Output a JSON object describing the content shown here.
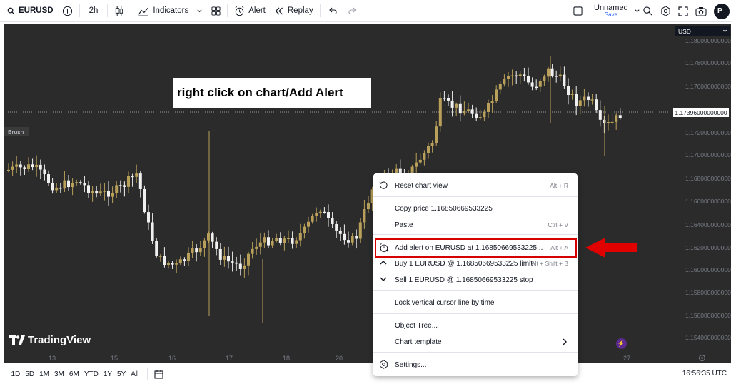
{
  "toolbar": {
    "symbol": "EURUSD",
    "interval": "2h",
    "indicators_label": "Indicators",
    "alert_label": "Alert",
    "replay_label": "Replay",
    "layout_name": "Unnamed",
    "layout_status": "Save",
    "avatar_text": "P"
  },
  "chart": {
    "currency": "USD",
    "brush_label": "Brush",
    "last_price": "1.17396000000000",
    "price_ticks": [
      "1.18000000000000",
      "1.17800000000000",
      "1.17600000000000",
      "1.17200000000000",
      "1.17000000000000",
      "1.16800000000000",
      "1.16600000000000",
      "1.16400000000000",
      "1.16200000000000",
      "1.16000000000000",
      "1.15800000000000",
      "1.15600000000000",
      "1.15400000000000"
    ],
    "date_ticks": [
      "13",
      "15",
      "16",
      "17",
      "18",
      "20",
      "27"
    ],
    "logo_text": "TradingView",
    "annotation": "right click on chart/Add Alert",
    "colors": {
      "bg": "#2b2b2b",
      "up": "#b8a05a",
      "down": "#f0f0f0",
      "accent": "#d50000"
    }
  },
  "ranges": [
    "1D",
    "5D",
    "1M",
    "3M",
    "6M",
    "YTD",
    "1Y",
    "5Y",
    "All"
  ],
  "clock": "16:56:35 UTC",
  "menu": {
    "items": [
      {
        "label": "Reset chart view",
        "shortcut": "Alt + R",
        "icon": "reset-icon"
      },
      {
        "label": "Copy price 1.16850669533225",
        "shortcut": "",
        "icon": ""
      },
      {
        "label": "Paste",
        "shortcut": "Ctrl + V",
        "icon": ""
      },
      {
        "label": "Add alert on EURUSD at 1.16850669533225...",
        "shortcut": "Alt + A",
        "icon": "alarm-icon"
      },
      {
        "label": "Buy 1 EURUSD @ 1.16850669533225 limit",
        "shortcut": "Alt + Shift + B",
        "icon": "chevron-up-icon"
      },
      {
        "label": "Sell 1 EURUSD @ 1.16850669533225 stop",
        "shortcut": "",
        "icon": "chevron-down-icon"
      },
      {
        "label": "Lock vertical cursor line by time",
        "shortcut": "",
        "icon": ""
      },
      {
        "label": "Object Tree...",
        "shortcut": "",
        "icon": ""
      },
      {
        "label": "Chart template",
        "shortcut": "",
        "icon": "chevron-right-icon"
      },
      {
        "label": "Settings...",
        "shortcut": "",
        "icon": "gear-icon"
      }
    ]
  }
}
